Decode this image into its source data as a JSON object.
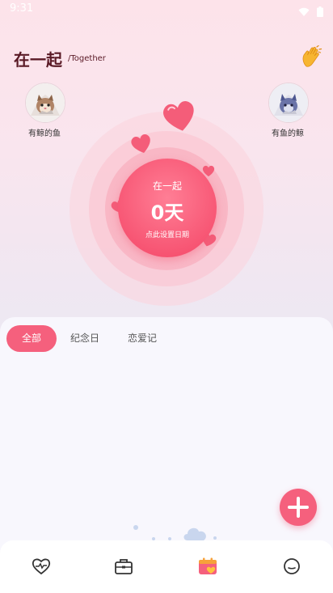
{
  "status": {
    "time": "9:31"
  },
  "header": {
    "title": "在一起",
    "subtitle": "/Together"
  },
  "users": [
    {
      "name": "有鲸的鱼"
    },
    {
      "name": "有鱼的鲸"
    }
  ],
  "counter": {
    "label": "在一起",
    "days": "0天",
    "hint": "点此设置日期"
  },
  "tabs": [
    {
      "label": "全部",
      "active": true
    },
    {
      "label": "纪念日",
      "active": false
    },
    {
      "label": "恋爱记",
      "active": false
    }
  ],
  "colors": {
    "accent": "#f5607d",
    "title": "#5a1a26"
  },
  "nav": [
    {
      "icon": "heart-pulse-icon"
    },
    {
      "icon": "briefcase-icon"
    },
    {
      "icon": "calendar-heart-icon",
      "active": true
    },
    {
      "icon": "smile-icon"
    }
  ]
}
